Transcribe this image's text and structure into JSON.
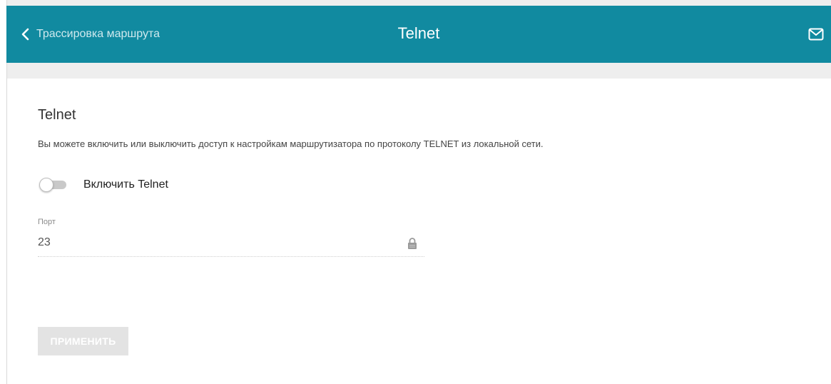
{
  "header": {
    "back_label": "Трассировка маршрута",
    "title": "Telnet",
    "back_icon": "chevron-left-icon",
    "mail_icon": "mail-icon"
  },
  "section": {
    "title": "Telnet",
    "description": "Вы можете включить или выключить доступ к настройкам маршрутизатора по протоколу TELNET из локальной сети."
  },
  "toggle": {
    "label": "Включить Telnet",
    "enabled": false
  },
  "port": {
    "label": "Порт",
    "value": "23",
    "lock_icon": "lock-icon"
  },
  "apply_label": "ПРИМЕНИТЬ",
  "colors": {
    "header": "#118aa0",
    "background": "#eeeeee"
  }
}
